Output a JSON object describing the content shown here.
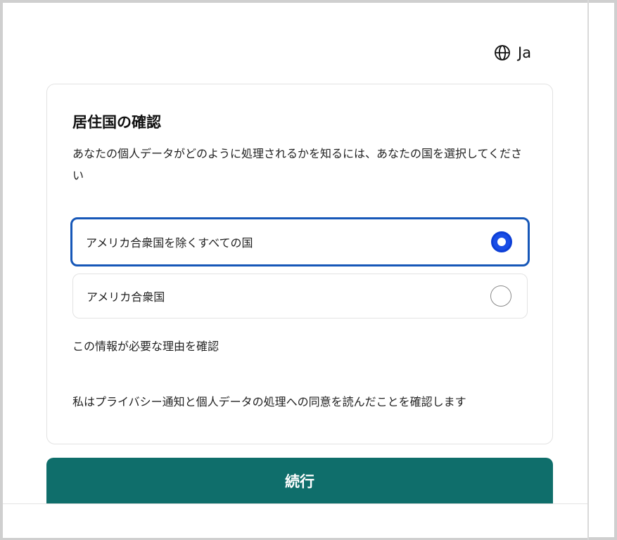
{
  "language": {
    "label": "Ja",
    "icon": "globe-icon"
  },
  "card": {
    "title": "居住国の確認",
    "description": "あなたの個人データがどのように処理されるかを知るには、あなたの国を選択してください",
    "options": [
      {
        "label": "アメリカ合衆国を除くすべての国",
        "selected": true
      },
      {
        "label": "アメリカ合衆国",
        "selected": false
      }
    ],
    "why_link": "この情報が必要な理由を確認",
    "consent": "私はプライバシー通知と個人データの処理への同意を読んだことを確認します"
  },
  "continue_button": "続行",
  "colors": {
    "accent": "#0f6e6b",
    "selected_border": "#1657b8",
    "radio_on": "#1a4ee6"
  }
}
